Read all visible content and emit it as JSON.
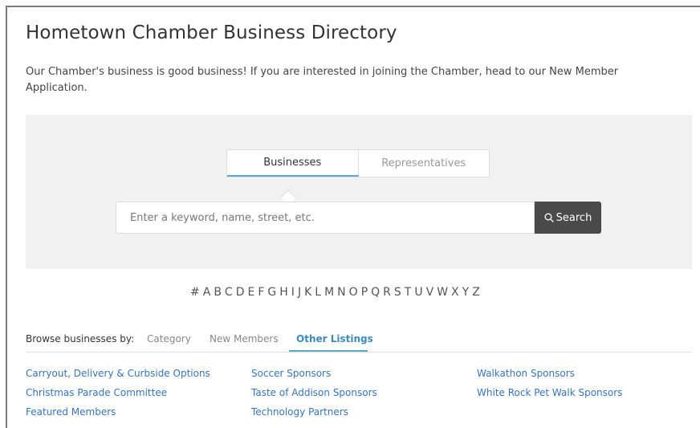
{
  "page": {
    "title": "Hometown Chamber Business Directory",
    "intro": "Our Chamber's business is good business! If you are interested in joining the Chamber, head to our New Member Application."
  },
  "search": {
    "tabs": [
      {
        "label": "Businesses",
        "active": true
      },
      {
        "label": "Representatives",
        "active": false
      }
    ],
    "placeholder": "Enter a keyword, name, street, etc.",
    "button_label": "Search",
    "button_icon": "search-icon"
  },
  "alphabet": [
    "#",
    "A",
    "B",
    "C",
    "D",
    "E",
    "F",
    "G",
    "H",
    "I",
    "J",
    "K",
    "L",
    "M",
    "N",
    "O",
    "P",
    "Q",
    "R",
    "S",
    "T",
    "U",
    "V",
    "W",
    "X",
    "Y",
    "Z"
  ],
  "browse": {
    "label": "Browse businesses by:",
    "tabs": [
      {
        "label": "Category",
        "active": false
      },
      {
        "label": "New Members",
        "active": false
      },
      {
        "label": "Other Listings",
        "active": true
      }
    ]
  },
  "listings": {
    "col1": [
      "Carryout, Delivery & Curbside Options",
      "Christmas Parade Committee",
      "Featured Members"
    ],
    "col2": [
      "Soccer Sponsors",
      "Taste of Addison Sponsors",
      "Technology Partners"
    ],
    "col3": [
      "Walkathon Sponsors",
      "White Rock Pet Walk Sponsors"
    ]
  },
  "colors": {
    "accent": "#5aa9c9",
    "link": "#3574c4",
    "button": "#4a4a4a",
    "panel": "#f1f1f1"
  }
}
